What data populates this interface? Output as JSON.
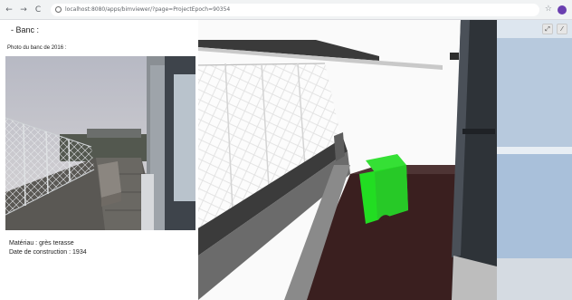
{
  "browser": {
    "back_icon": "←",
    "forward_icon": "→",
    "reload_icon": "C",
    "url": "localhost:8080/apps/bimviewer/?page=ProjectEpoch=90354",
    "star_icon": "☆"
  },
  "panel": {
    "title": "- Banc :",
    "photo_caption": "Photo du banc de 2016 :",
    "material": "Matériau : grès terasse",
    "construction_date": "Date de construction : 1934"
  },
  "viewer": {
    "tool_1": "⤢",
    "tool_2": "⁄",
    "bench_color": "#22dd22",
    "floor_color": "#3a1f1f"
  }
}
